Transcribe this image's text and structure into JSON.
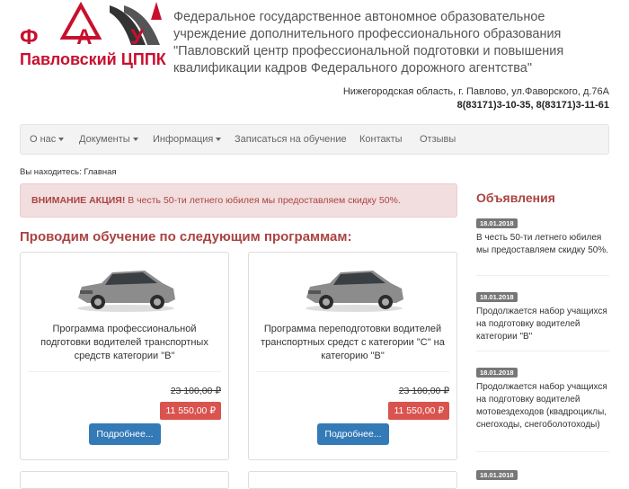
{
  "header": {
    "logo_fau": "Ф А У",
    "logo_name": "Павловский ЦППК",
    "org_title": "Федеральное государственное автономное образовательное учреждение дополнительного профессионального образования \"Павловский центр профессиональной подготовки и повышения квалификации кадров Федерального дорожного агентства\"",
    "address": "Нижегородская область, г. Павлово, ул.Фаворского, д.76А",
    "phones": "8(83171)3-10-35, 8(83171)3-11-61"
  },
  "nav": {
    "items": [
      {
        "label": "О нас",
        "dropdown": true
      },
      {
        "label": "Документы",
        "dropdown": true
      },
      {
        "label": "Информация",
        "dropdown": true
      },
      {
        "label": "Записаться на обучение",
        "dropdown": false
      },
      {
        "label": "Контакты",
        "dropdown": false
      },
      {
        "label": "Отзывы",
        "dropdown": false
      }
    ]
  },
  "breadcrumb": "Вы находитесь: Главная",
  "alert": {
    "strong": "ВНИМАНИЕ АКЦИЯ!",
    "text": " В честь 50-ти летнего юбилея мы предоставляем скидку 50%."
  },
  "programs_title": "Проводим обучение по следующим программам:",
  "programs": [
    {
      "title": "Программа профессиональной подготовки водителей транспортных средств категории \"В\"",
      "old_price": "23 100,00 ₽",
      "price": "11 550,00 ₽",
      "button": "Подробнее..."
    },
    {
      "title": "Программа переподготовки водителей транспортных средст с категории \"С\" на категорию \"В\"",
      "old_price": "23 100,00 ₽",
      "price": "11 550,00 ₽",
      "button": "Подробнее..."
    }
  ],
  "announcements_title": "Объявления",
  "announcements": [
    {
      "date": "18.01.2018",
      "text": "В честь 50-ти летнего юбилея мы предоставляем скидку 50%."
    },
    {
      "date": "18.01.2018",
      "text": "Продолжается набор учащихся на подготовку водителей категории \"В\""
    },
    {
      "date": "18.01.2018",
      "text": "Продолжается набор учащихся на подготовку водителей мотовездеходов (квадроциклы, снегоходы, снегоболотоходы)"
    },
    {
      "date": "18.01.2018",
      "text": ""
    }
  ],
  "colors": {
    "accent_red": "#c8102e",
    "heading_red": "#a94442",
    "price_red": "#d9534f",
    "button_blue": "#337ab7"
  }
}
